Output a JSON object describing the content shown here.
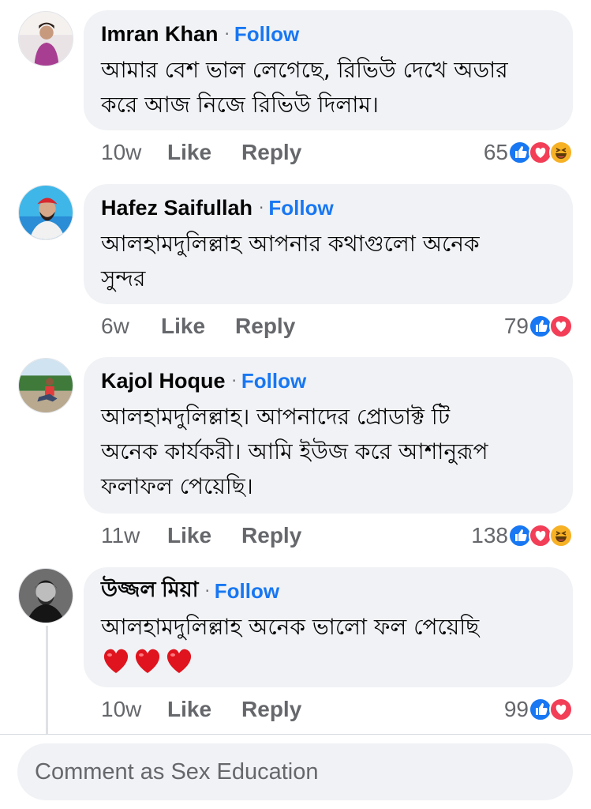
{
  "comments": [
    {
      "author": "Imran Khan",
      "follow": "Follow",
      "separator": "·",
      "lines": [
        "আমার বেশ ভাল লেগেছে, রিভিউ দেখে অডার",
        "করে আজ নিজে রিভিউ দিলাম।"
      ],
      "time": "10w",
      "like": "Like",
      "reply": "Reply",
      "reaction_count": "65",
      "reactions": [
        "like-icon",
        "love-icon",
        "haha-icon"
      ]
    },
    {
      "author": "Hafez Saifullah",
      "follow": "Follow",
      "separator": "·",
      "lines": [
        "আলহামদুলিল্লাহ আপনার কথাগুলো অনেক",
        "সুন্দর"
      ],
      "time": "6w",
      "like": "Like",
      "reply": "Reply",
      "reaction_count": "79",
      "reactions": [
        "like-icon",
        "love-icon"
      ]
    },
    {
      "author": "Kajol Hoque",
      "follow": "Follow",
      "separator": "·",
      "lines": [
        "আলহামদুলিল্লাহ। আপনাদের প্রোডাক্ট টি",
        "অনেক কার্যকরী। আমি ইউজ করে আশানুরূপ",
        "ফলাফল পেয়েছি।"
      ],
      "time": "11w",
      "like": "Like",
      "reply": "Reply",
      "reaction_count": "138",
      "reactions": [
        "like-icon",
        "love-icon",
        "haha-icon"
      ]
    },
    {
      "author": "উজ্জল মিয়া",
      "follow": "Follow",
      "separator": "·",
      "lines": [
        "আলহামদুলিল্লাহ অনেক ভালো ফল পেয়েছি"
      ],
      "emoji": [
        "red-heart-icon",
        "red-heart-icon",
        "red-heart-icon"
      ],
      "time": "10w",
      "like": "Like",
      "reply": "Reply",
      "reaction_count": "99",
      "reactions": [
        "like-icon",
        "love-icon"
      ]
    }
  ],
  "composer": {
    "placeholder": "Comment as Sex Education"
  },
  "colors": {
    "follow": "#1877f2",
    "bubble": "#f0f2f5",
    "muted": "#65676b",
    "like": "#1877f2",
    "love": "#f33e58",
    "haha": "#f7b125"
  }
}
